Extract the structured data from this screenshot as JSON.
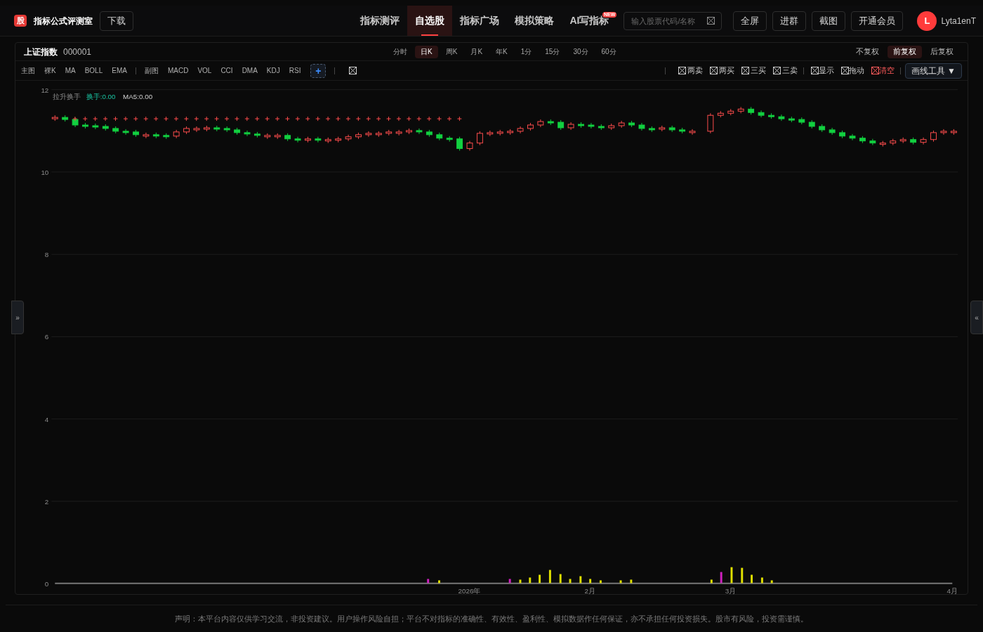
{
  "brand": {
    "logo": "股",
    "title": "指标公式评测室",
    "download": "下载"
  },
  "nav": [
    {
      "label": "指标测评",
      "selected": false
    },
    {
      "label": "自选股",
      "selected": true
    },
    {
      "label": "指标广场",
      "selected": false
    },
    {
      "label": "模拟策略",
      "selected": false
    },
    {
      "label": "AI写指标",
      "selected": false,
      "badge": "NEW"
    }
  ],
  "search": {
    "placeholder": "输入股票代码/名称"
  },
  "actions": [
    "全屏",
    "进群",
    "截图",
    "开通会员"
  ],
  "user": {
    "initial": "L",
    "name": "Lyta1enT"
  },
  "stock": {
    "name": "上证指数",
    "code": "000001"
  },
  "periods": [
    {
      "label": "分时",
      "selected": false
    },
    {
      "label": "日K",
      "selected": true
    },
    {
      "label": "周K",
      "selected": false
    },
    {
      "label": "月K",
      "selected": false
    },
    {
      "label": "年K",
      "selected": false
    },
    {
      "label": "1分",
      "selected": false
    },
    {
      "label": "15分",
      "selected": false
    },
    {
      "label": "30分",
      "selected": false
    },
    {
      "label": "60分",
      "selected": false
    }
  ],
  "adjust": [
    {
      "label": "不复权",
      "selected": false
    },
    {
      "label": "前复权",
      "selected": true
    },
    {
      "label": "后复权",
      "selected": false
    }
  ],
  "main_indicators": {
    "label": "主图",
    "items": [
      "裸K",
      "MA",
      "BOLL",
      "EMA"
    ]
  },
  "sub_indicators": {
    "label": "副图",
    "items": [
      "MACD",
      "VOL",
      "CCI",
      "DMA",
      "KDJ",
      "RSI"
    ]
  },
  "add_button": "+",
  "signals": [
    {
      "label": "两卖"
    },
    {
      "label": "两买"
    },
    {
      "label": "三买"
    },
    {
      "label": "三卖"
    }
  ],
  "toggles": [
    {
      "label": "显示",
      "kind": "normal"
    },
    {
      "label": "拖动",
      "kind": "normal"
    },
    {
      "label": "清空",
      "kind": "danger"
    }
  ],
  "draw_tools": {
    "label": "画线工具",
    "caret": "▼"
  },
  "chart": {
    "yaxis": [
      "12",
      "10",
      "8",
      "6",
      "4",
      "2",
      "0"
    ],
    "legend": [
      {
        "text": "拉升换手",
        "kind": "label"
      },
      {
        "text": "换手:0.00",
        "kind": "accent"
      },
      {
        "text": "MA5:0.00",
        "kind": "value"
      }
    ],
    "xaxis": [
      "2026年",
      "2月",
      "3月",
      "4月"
    ]
  },
  "expand_left": "»",
  "expand_right": "«",
  "disclaimer": "声明：本平台内容仅供学习交流，非投资建议。用户操作风险自担；平台不对指标的准确性、有效性、盈利性、模拟数据作任何保证，亦不承担任何投资损失。股市有风险，投资需谨慎。"
}
